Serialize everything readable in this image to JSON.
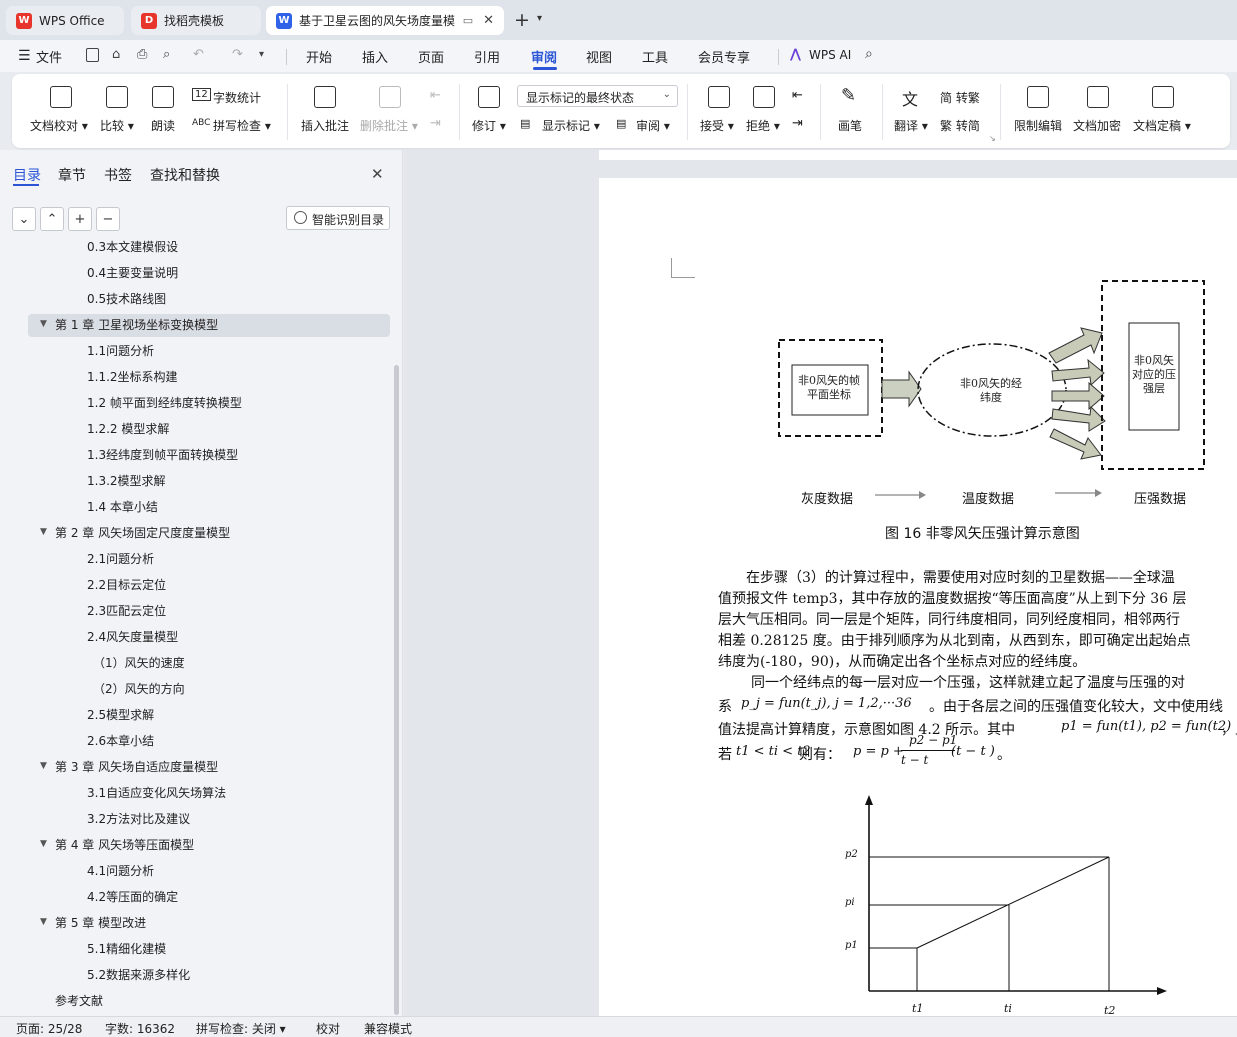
{
  "titlebar": {
    "tabs": [
      {
        "label": "WPS Office",
        "icon": "wps-logo-icon"
      },
      {
        "label": "找稻壳模板",
        "icon": "docer-logo-icon"
      },
      {
        "label": "基于卫星云图的风矢场度量模",
        "icon": "writer-logo-icon"
      }
    ],
    "new_tab": "+"
  },
  "menubar": {
    "file": "文件",
    "items": [
      "开始",
      "插入",
      "页面",
      "引用",
      "审阅",
      "视图",
      "工具",
      "会员专享"
    ],
    "active": "审阅",
    "wps_ai": "WPS AI"
  },
  "ribbon": {
    "doc_proof": "文档校对",
    "compare": "比较",
    "read_aloud": "朗读",
    "word_count": "字数统计",
    "spell_check": "拼写检查",
    "insert_comment": "插入批注",
    "delete_comment": "删除批注",
    "revise": "修订",
    "display_mode": "显示标记的最终状态",
    "show_markup": "显示标记",
    "review": "审阅",
    "accept": "接受",
    "reject": "拒绝",
    "pen": "画笔",
    "translate": "翻译",
    "trad_simp": "简 转繁",
    "simp_trad": "繁 转简",
    "restrict_edit": "限制编辑",
    "doc_encrypt": "文档加密",
    "doc_finalize": "文档定稿"
  },
  "panel": {
    "tabs": [
      "目录",
      "章节",
      "书签",
      "查找和替换"
    ],
    "active_tab": "目录",
    "smart_toc": "智能识别目录",
    "toc": [
      {
        "text": "0.3本文建模假设",
        "level": 2
      },
      {
        "text": "0.4主要变量说明",
        "level": 2
      },
      {
        "text": "0.5技术路线图",
        "level": 2
      },
      {
        "text": "第 1 章 卫星视场坐标变换模型",
        "level": 1,
        "selected": true
      },
      {
        "text": "1.1问题分析",
        "level": 2
      },
      {
        "text": "1.1.2坐标系构建",
        "level": 2
      },
      {
        "text": "1.2 帧平面到经纬度转换模型",
        "level": 2
      },
      {
        "text": "1.2.2 模型求解",
        "level": 2
      },
      {
        "text": "1.3经纬度到帧平面转换模型",
        "level": 2
      },
      {
        "text": "1.3.2模型求解",
        "level": 2
      },
      {
        "text": "1.4 本章小结",
        "level": 2
      },
      {
        "text": "第 2 章 风矢场固定尺度度量模型",
        "level": 1
      },
      {
        "text": "2.1问题分析",
        "level": 2
      },
      {
        "text": "2.2目标云定位",
        "level": 2
      },
      {
        "text": "2.3匹配云定位",
        "level": 2
      },
      {
        "text": "2.4风矢度量模型",
        "level": 2
      },
      {
        "text": "（1）风矢的速度",
        "level": 3
      },
      {
        "text": "（2）风矢的方向",
        "level": 3
      },
      {
        "text": "2.5模型求解",
        "level": 2
      },
      {
        "text": "2.6本章小结",
        "level": 2
      },
      {
        "text": "第 3 章 风矢场自适应度量模型",
        "level": 1
      },
      {
        "text": "3.1自适应变化风矢场算法",
        "level": 2
      },
      {
        "text": "3.2方法对比及建议",
        "level": 2
      },
      {
        "text": "第 4 章 风矢场等压面模型",
        "level": 1
      },
      {
        "text": "4.1问题分析",
        "level": 2
      },
      {
        "text": "4.2等压面的确定",
        "level": 2
      },
      {
        "text": "第 5 章 模型改进",
        "level": 1
      },
      {
        "text": "5.1精细化建模",
        "level": 2
      },
      {
        "text": "5.2数据来源多样化",
        "level": 2
      },
      {
        "text": "参考文献",
        "level": 0
      }
    ]
  },
  "document": {
    "diagram": {
      "box_left": "非0风矢的帧平面坐标",
      "ellipse": "非0风矢的经纬度",
      "box_right": "非0风矢对应的压强层",
      "flow_1": "灰度数据",
      "flow_2": "温度数据",
      "flow_3": "压强数据"
    },
    "caption": "图 16  非零风矢压强计算示意图",
    "para_lines": [
      "在步骤（3）的计算过程中，需要使用对应时刻的卫星数据——全球温",
      "值预报文件  temp3，其中存放的温度数据按“等压面高度”从上到下分  36 层",
      "层大气压相同。同一层是个矩阵，同行纬度相同，同列经度相同，相邻两行",
      "相差 0.28125 度。由于排列顺序为从北到南，从西到东，即可确定出起始点",
      "纬度为(-180，90)，从而确定出各个坐标点对应的经纬度。",
      "同一个经纬点的每一层对应一个压强，这样就建立起了温度与压强的对",
      "。由于各层之间的压强值变化较大，文中使用线",
      "值法提高计算精度，示意图如图  4.2 所示。其中",
      "，且",
      "若",
      "则有：",
      "。"
    ],
    "math": {
      "sys_prefix": "系",
      "relation": "p_j = fun(t_j), j = 1,2,···36",
      "defs": "p1 = fun(t1),  p2 = fun(t2)",
      "cond": "t1 < ti < t2",
      "formula_left": "p = p +",
      "formula_num": "p2 − p1",
      "formula_den": "t − t",
      "formula_tail": "(t − t )"
    },
    "graph": {
      "y_labels": [
        "p2",
        "pi",
        "p1"
      ],
      "x_labels": [
        "t1",
        "ti",
        "t2"
      ]
    }
  },
  "statusbar": {
    "page": "页面: 25/28",
    "words": "字数: 16362",
    "spell": "拼写检查: 关闭",
    "proof": "校对",
    "compat": "兼容模式"
  }
}
